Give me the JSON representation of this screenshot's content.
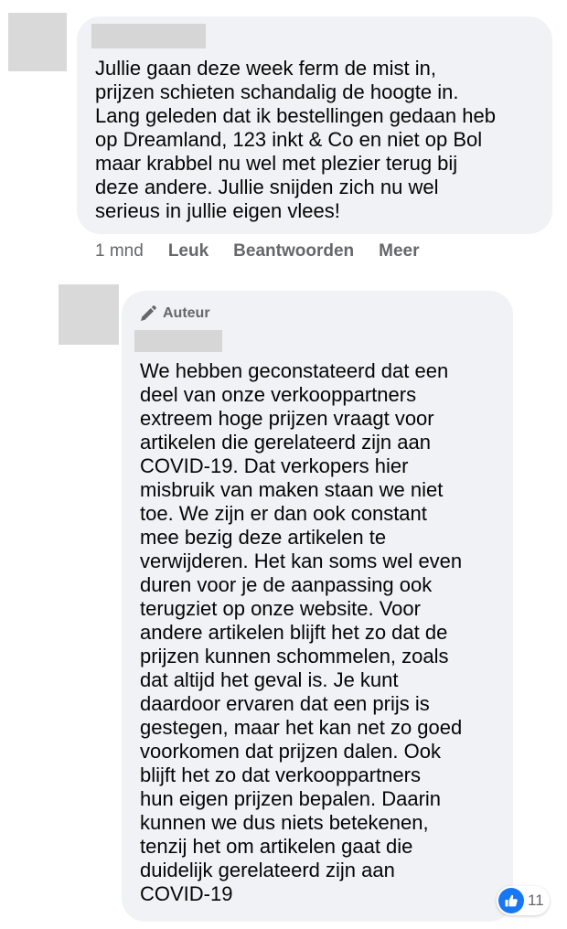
{
  "comment": {
    "text": "Jullie gaan deze week ferm de mist in,\nprijzen schieten schandalig de hoogte in.\nLang geleden dat ik bestellingen gedaan heb\nop Dreamland, 123 inkt & Co en niet op Bol\nmaar krabbel nu wel met plezier terug bij\ndeze andere. Jullie snijden zich nu wel\nserieus in jullie eigen vlees!",
    "time": "1 mnd",
    "actions": {
      "like": "Leuk",
      "reply": "Beantwoorden",
      "more": "Meer"
    }
  },
  "reply": {
    "badge": "Auteur",
    "text": "We hebben geconstateerd dat een\ndeel van onze verkooppartners\nextreem hoge prijzen vraagt voor\nartikelen die gerelateerd zijn aan\nCOVID-19. Dat verkopers hier\nmisbruik van maken staan we niet\ntoe. We zijn er dan ook constant\nmee bezig deze artikelen te\nverwijderen. Het kan soms wel even\nduren voor je de aanpassing ook\nterugziet op onze website. Voor\nandere artikelen blijft het zo dat de\nprijzen kunnen schommelen, zoals\ndat altijd het geval is. Je kunt\ndaardoor ervaren dat een prijs is\ngestegen, maar het kan net zo goed\nvoorkomen dat prijzen dalen. Ook\nblijft het zo dat verkooppartners\nhun eigen prijzen bepalen. Daarin\nkunnen we dus niets betekenen,\ntenzij het om artikelen gaat die\nduidelijk gerelateerd zijn aan\nCOVID-19",
    "reaction_count": "11",
    "reaction_icon": "like-icon"
  },
  "colors": {
    "bubble": "#f0f2f5",
    "meta_text": "#65676b",
    "like_blue": "#1877f2",
    "redaction": "#d6d6d6"
  }
}
